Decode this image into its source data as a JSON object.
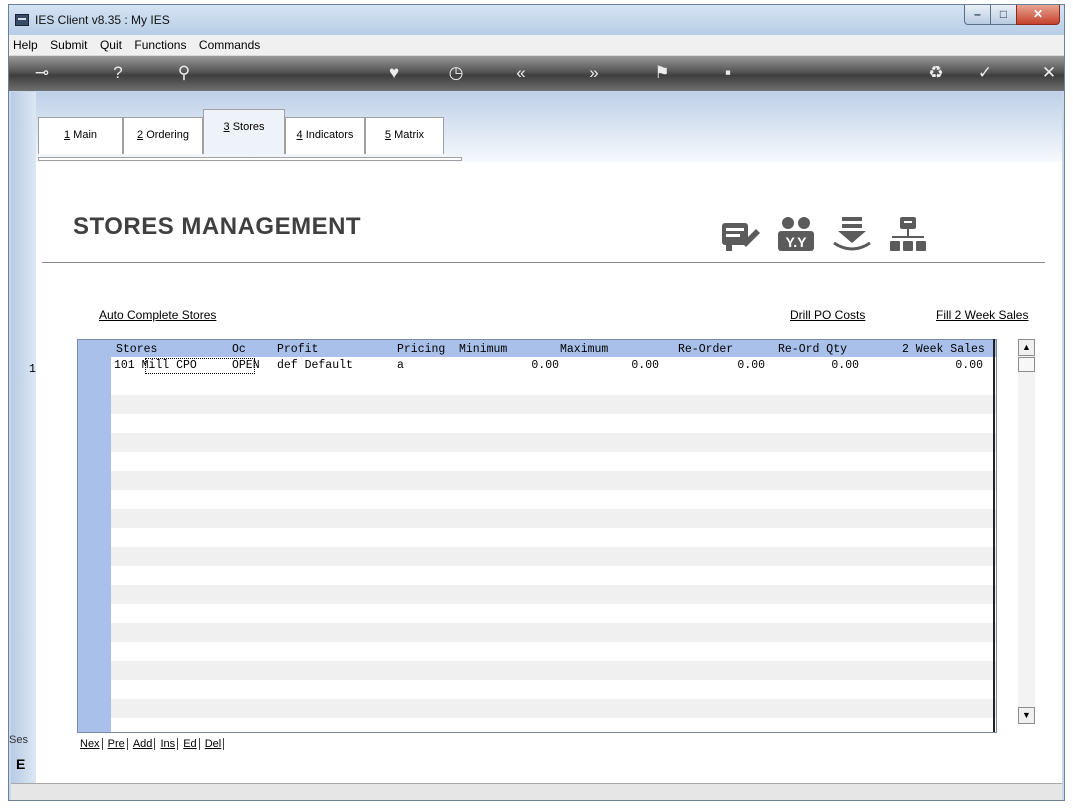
{
  "window": {
    "title": "IES Client v8.35 : My IES"
  },
  "menu": [
    "Help",
    "Submit",
    "Quit",
    "Functions",
    "Commands"
  ],
  "toolbar_icons": [
    "key-icon",
    "help-icon",
    "search-icon",
    "heart-icon",
    "clock-icon",
    "rewind-icon",
    "forward-icon",
    "flag-icon",
    "save-icon",
    "recycle-icon",
    "check-icon",
    "close-icon"
  ],
  "tabs": [
    {
      "key": "1",
      "label": "Main"
    },
    {
      "key": "2",
      "label": "Ordering"
    },
    {
      "key": "3",
      "label": "Stores"
    },
    {
      "key": "4",
      "label": "Indicators"
    },
    {
      "key": "5",
      "label": "Matrix"
    }
  ],
  "active_tab": "Stores",
  "page_title": "STORES MANAGEMENT",
  "header_icons": [
    "notes-edit-icon",
    "people-icon",
    "download-icon",
    "hierarchy-icon"
  ],
  "links": {
    "auto_complete": "Auto Complete Stores",
    "drill_po": "Drill PO Costs",
    "fill_sales": "Fill 2 Week Sales"
  },
  "grid": {
    "columns": [
      "Stores",
      "Oc",
      "Profit",
      "Pricing",
      "Minimum",
      "Maximum",
      "Re-Order",
      "Re-Ord Qty",
      "2 Week Sales"
    ],
    "rows": [
      {
        "num": "1",
        "store": "101 Mill CPO",
        "oc": "OPEN",
        "profit": "def Default",
        "pricing": "a",
        "minimum": "0.00",
        "maximum": "0.00",
        "reorder": "0.00",
        "reordqty": "0.00",
        "sales": "0.00"
      }
    ]
  },
  "nav": [
    "Nex",
    "Pre",
    "Add",
    "Ins",
    "Ed",
    "Del"
  ],
  "side": {
    "ses": "Ses",
    "char": "E"
  }
}
